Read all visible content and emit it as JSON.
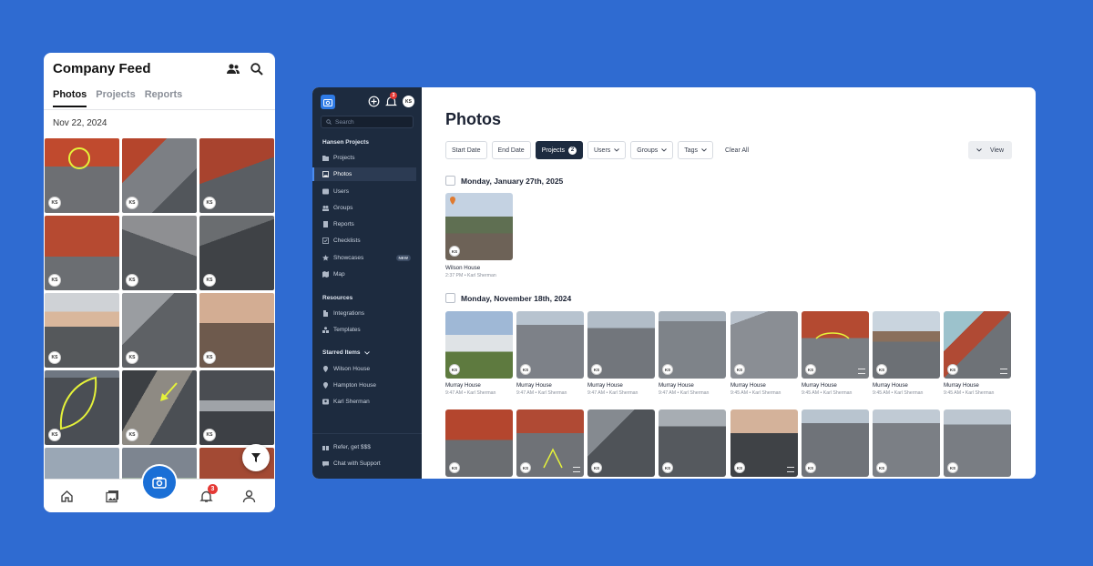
{
  "colors": {
    "background": "#2f6bd1",
    "sidebar": "#1d2b3f",
    "accent": "#1a6fd6",
    "badge": "#e53935"
  },
  "mobile": {
    "title": "Company Feed",
    "header_icons": [
      "people-icon",
      "search-icon"
    ],
    "tabs": [
      {
        "label": "Photos",
        "active": true
      },
      {
        "label": "Projects",
        "active": false
      },
      {
        "label": "Reports",
        "active": false
      }
    ],
    "date": "Nov 22, 2024",
    "avatar_initials": "KS",
    "photo_count": 15,
    "nav": {
      "notification_count": "3"
    }
  },
  "desktop": {
    "sidebar": {
      "avatar_initials": "KS",
      "notification_count": "3",
      "search_placeholder": "Search",
      "section_company": "Hansen Projects",
      "nav_items": [
        {
          "label": "Projects",
          "icon": "folder-icon"
        },
        {
          "label": "Photos",
          "icon": "photos-icon",
          "active": true
        },
        {
          "label": "Users",
          "icon": "users-icon"
        },
        {
          "label": "Groups",
          "icon": "groups-icon"
        },
        {
          "label": "Reports",
          "icon": "reports-icon"
        },
        {
          "label": "Checklists",
          "icon": "checklist-icon"
        },
        {
          "label": "Showcases",
          "icon": "showcase-icon",
          "tag": "NEW"
        },
        {
          "label": "Map",
          "icon": "map-icon"
        }
      ],
      "section_resources": "Resources",
      "resource_items": [
        {
          "label": "Integrations",
          "icon": "integrations-icon"
        },
        {
          "label": "Templates",
          "icon": "templates-icon"
        }
      ],
      "section_starred": "Starred Items",
      "starred_items": [
        {
          "label": "Wilson House",
          "icon": "location-pin-icon"
        },
        {
          "label": "Hampton House",
          "icon": "location-pin-icon"
        },
        {
          "label": "Karl Sherman",
          "icon": "contact-card-icon"
        }
      ],
      "bottom_items": [
        {
          "label": "Refer, get $$$",
          "icon": "gift-icon"
        },
        {
          "label": "Chat with Support",
          "icon": "chat-icon"
        }
      ]
    },
    "title": "Photos",
    "filters": {
      "start_date": "Start Date",
      "end_date": "End Date",
      "projects": "Projects",
      "projects_count": "2",
      "users": "Users",
      "groups": "Groups",
      "tags": "Tags",
      "clear_all": "Clear All",
      "view": "View"
    },
    "groups": [
      {
        "date": "Monday, January 27th, 2025",
        "photos": [
          {
            "name": "Wilson House",
            "meta": "2:37 PM • Karl Sherman",
            "initials": "KS"
          }
        ]
      },
      {
        "date": "Monday, November 18th, 2024",
        "photos": [
          {
            "name": "Murray House",
            "meta": "9:47 AM • Karl Sherman",
            "initials": "KS"
          },
          {
            "name": "Murray House",
            "meta": "9:47 AM • Karl Sherman",
            "initials": "KS"
          },
          {
            "name": "Murray House",
            "meta": "9:47 AM • Karl Sherman",
            "initials": "KS"
          },
          {
            "name": "Murray House",
            "meta": "9:47 AM • Karl Sherman",
            "initials": "KS"
          },
          {
            "name": "Murray House",
            "meta": "9:45 AM • Karl Sherman",
            "initials": "KS"
          },
          {
            "name": "Murray House",
            "meta": "9:45 AM • Karl Sherman",
            "initials": "KS"
          },
          {
            "name": "Murray House",
            "meta": "9:45 AM • Karl Sherman",
            "initials": "KS"
          },
          {
            "name": "Murray House",
            "meta": "9:45 AM • Karl Sherman",
            "initials": "KS"
          }
        ]
      }
    ],
    "extra_row_initials": "KS"
  }
}
